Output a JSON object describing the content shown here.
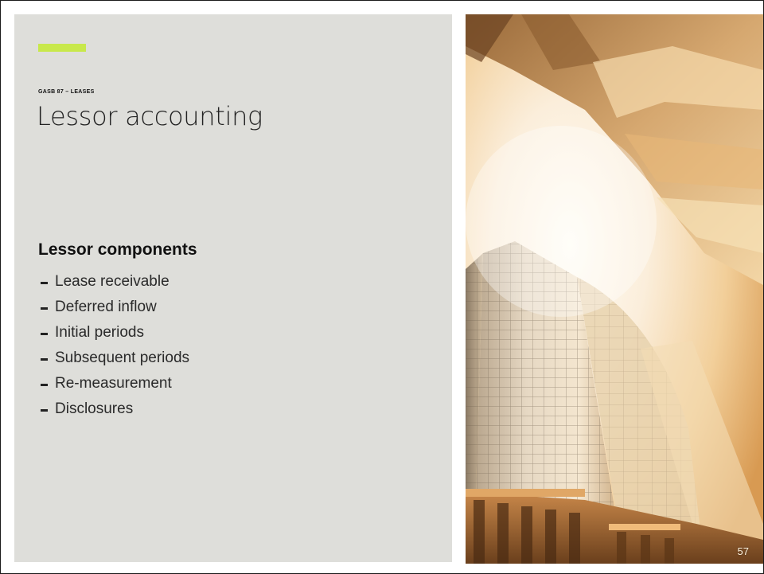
{
  "slide": {
    "kicker": "GASB 87 – LEASES",
    "title": "Lessor accounting",
    "section_heading": "Lessor components",
    "bullets": [
      "Lease receivable",
      "Deferred inflow",
      "Initial periods",
      "Subsequent periods",
      "Re-measurement",
      "Disclosures"
    ],
    "page_number": "57"
  },
  "colors": {
    "accent": "#c8e84b",
    "panel_background": "#dededa",
    "text_dark": "#222222"
  }
}
